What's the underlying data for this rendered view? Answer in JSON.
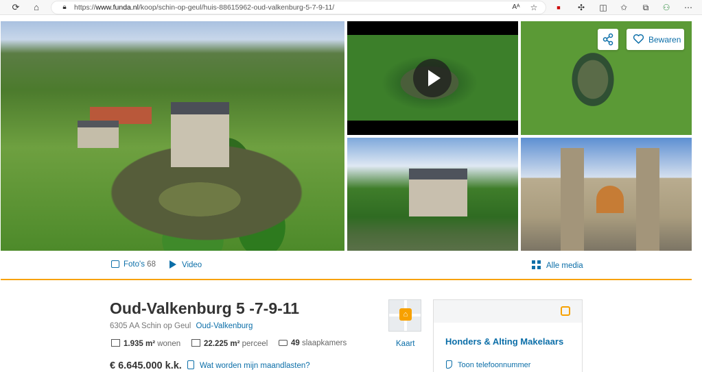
{
  "browser": {
    "url_prefix": "https://",
    "url_domain": "www.funda.nl",
    "url_path": "/koop/schin-op-geul/huis-88615962-oud-valkenburg-5-7-9-11/",
    "icons": [
      "back-icon",
      "home-icon",
      "lock-icon",
      "read-aloud-icon",
      "favorite-star-icon",
      "extension-icon",
      "split-screen-icon",
      "favorites-icon",
      "collections-icon",
      "profile-icon",
      "more-icon"
    ]
  },
  "gallery": {
    "save_label": "Bewaren",
    "photos_label": "Foto's",
    "photos_count": "68",
    "video_label": "Video",
    "all_media_label": "Alle media"
  },
  "listing": {
    "title": "Oud-Valkenburg 5 -7-9-11",
    "postcode_city": "6305 AA Schin op Geul",
    "neighbourhood": "Oud-Valkenburg",
    "living_area": "1.935 m²",
    "living_label": "wonen",
    "plot_area": "22.225 m²",
    "plot_label": "perceel",
    "bedrooms": "49",
    "bedrooms_label": "slaapkamers",
    "price": "€ 6.645.000 k.k.",
    "monthly_costs_link": "Wat worden mijn maandlasten?",
    "map_label": "Kaart"
  },
  "agent": {
    "name": "Honders & Alting Makelaars",
    "phone_label": "Toon telefoonnummer"
  },
  "colors": {
    "link": "#0b6ea8",
    "accent": "#f7a100"
  }
}
